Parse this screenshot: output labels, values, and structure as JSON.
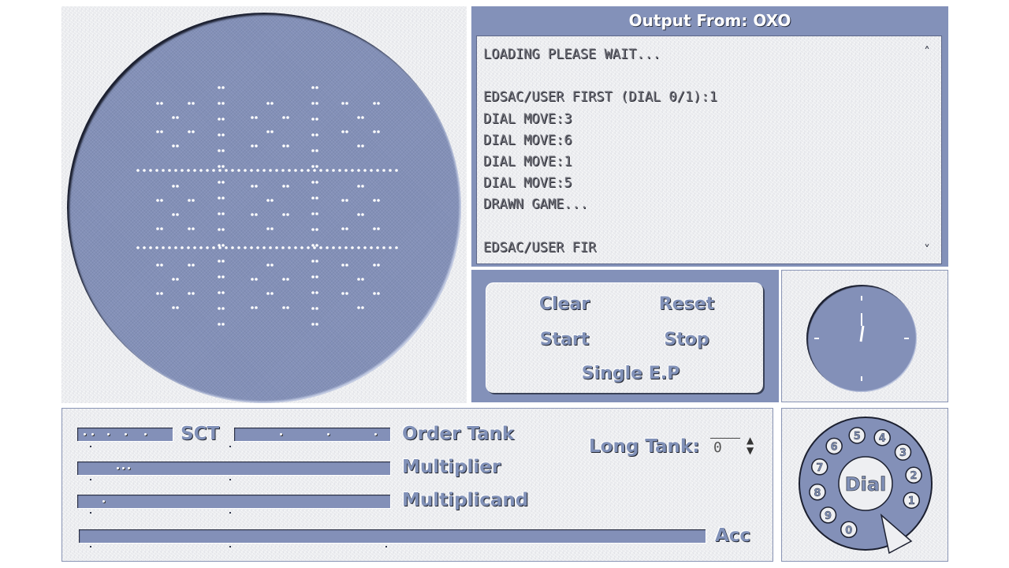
{
  "output": {
    "title": "Output From: OXO",
    "lines": [
      "LOADING PLEASE WAIT...",
      "",
      "EDSAC/USER FIRST (DIAL 0/1):1",
      "DIAL MOVE:3",
      "DIAL MOVE:6",
      "DIAL MOVE:1",
      "DIAL MOVE:5",
      "DRAWN GAME...",
      "",
      "EDSAC/USER FIR"
    ],
    "scroll_up": "^",
    "scroll_down": "v"
  },
  "controls": {
    "clear": "Clear",
    "reset": "Reset",
    "start": "Start",
    "stop": "Stop",
    "single_ep": "Single E.P"
  },
  "registers": {
    "sct": "SCT",
    "order_tank": "Order Tank",
    "multiplier": "Multiplier",
    "multiplicand": "Multiplicand",
    "acc": "Acc",
    "long_tank_label": "Long Tank:",
    "long_tank_value": "0"
  },
  "dial": {
    "label": "Dial",
    "digits": [
      "0",
      "9",
      "8",
      "7",
      "6",
      "5",
      "4",
      "3",
      "2",
      "1"
    ]
  },
  "colors": {
    "accent": "#8391b9",
    "panel": "#eeeff2",
    "dot": "#ffffff"
  }
}
